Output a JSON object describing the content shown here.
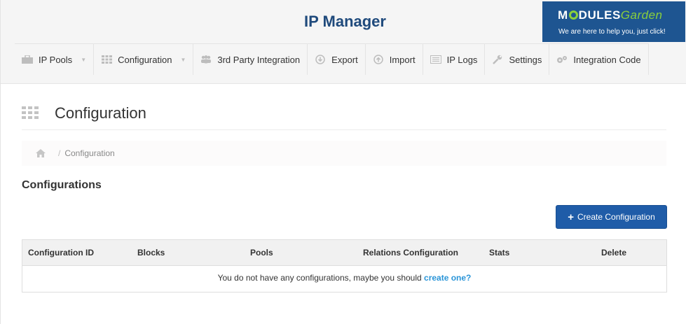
{
  "app": {
    "title": "IP Manager"
  },
  "brand": {
    "name_part1": "M",
    "name_part2": "DULES",
    "name_part3": "Garden",
    "tagline": "We are here to help you, just click!"
  },
  "nav": {
    "items": [
      {
        "label": "IP Pools",
        "icon": "briefcase-icon",
        "dropdown": true
      },
      {
        "label": "Configuration",
        "icon": "grid-icon",
        "dropdown": true
      },
      {
        "label": "3rd Party Integration",
        "icon": "users-icon",
        "dropdown": false
      },
      {
        "label": "Export",
        "icon": "download-icon",
        "dropdown": false
      },
      {
        "label": "Import",
        "icon": "upload-icon",
        "dropdown": false
      },
      {
        "label": "IP Logs",
        "icon": "list-icon",
        "dropdown": false
      },
      {
        "label": "Settings",
        "icon": "wrench-icon",
        "dropdown": false
      },
      {
        "label": "Integration Code",
        "icon": "cogs-icon",
        "dropdown": false
      }
    ]
  },
  "page": {
    "title": "Configuration"
  },
  "breadcrumb": {
    "current": "Configuration"
  },
  "section": {
    "title": "Configurations"
  },
  "actions": {
    "create_label": "Create Configuration"
  },
  "table": {
    "columns": [
      "Configuration ID",
      "Blocks",
      "Pools",
      "Relations Configuration",
      "Stats",
      "Delete"
    ],
    "empty_text": "You do not have any configurations, maybe you should",
    "empty_link": "create one?"
  }
}
